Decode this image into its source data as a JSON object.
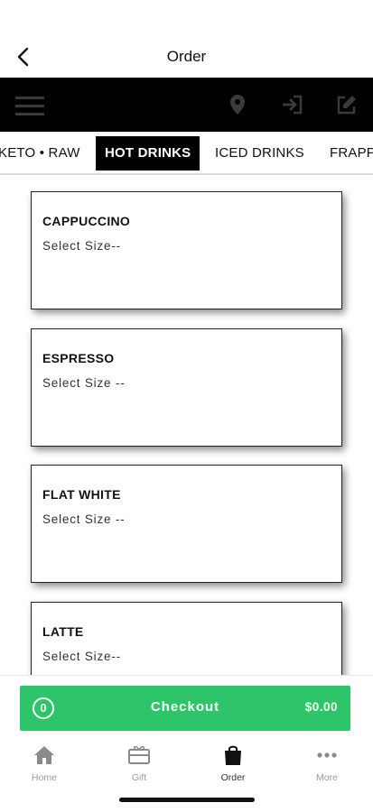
{
  "header": {
    "title": "Order"
  },
  "categories": {
    "tabs": [
      {
        "label": "KETO • RAW"
      },
      {
        "label": "HOT DRINKS",
        "active": true
      },
      {
        "label": "ICED DRINKS"
      },
      {
        "label": "FRAPPÉ"
      }
    ]
  },
  "products": [
    {
      "name": "CAPPUCCINO",
      "size_prompt": "Select Size--"
    },
    {
      "name": "ESPRESSO",
      "size_prompt": "Select Size --"
    },
    {
      "name": "FLAT WHITE",
      "size_prompt": "Select Size --"
    },
    {
      "name": "LATTE",
      "size_prompt": "Select Size--"
    }
  ],
  "checkout": {
    "count": "0",
    "label": "Checkout",
    "total": "$0.00",
    "color": "#2ec46a"
  },
  "tabbar": {
    "items": [
      {
        "label": "Home",
        "icon": "home-icon"
      },
      {
        "label": "Gift",
        "icon": "gift-card-icon"
      },
      {
        "label": "Order",
        "icon": "shopping-bag-icon",
        "active": true
      },
      {
        "label": "More",
        "icon": "more-dots-icon"
      }
    ]
  }
}
